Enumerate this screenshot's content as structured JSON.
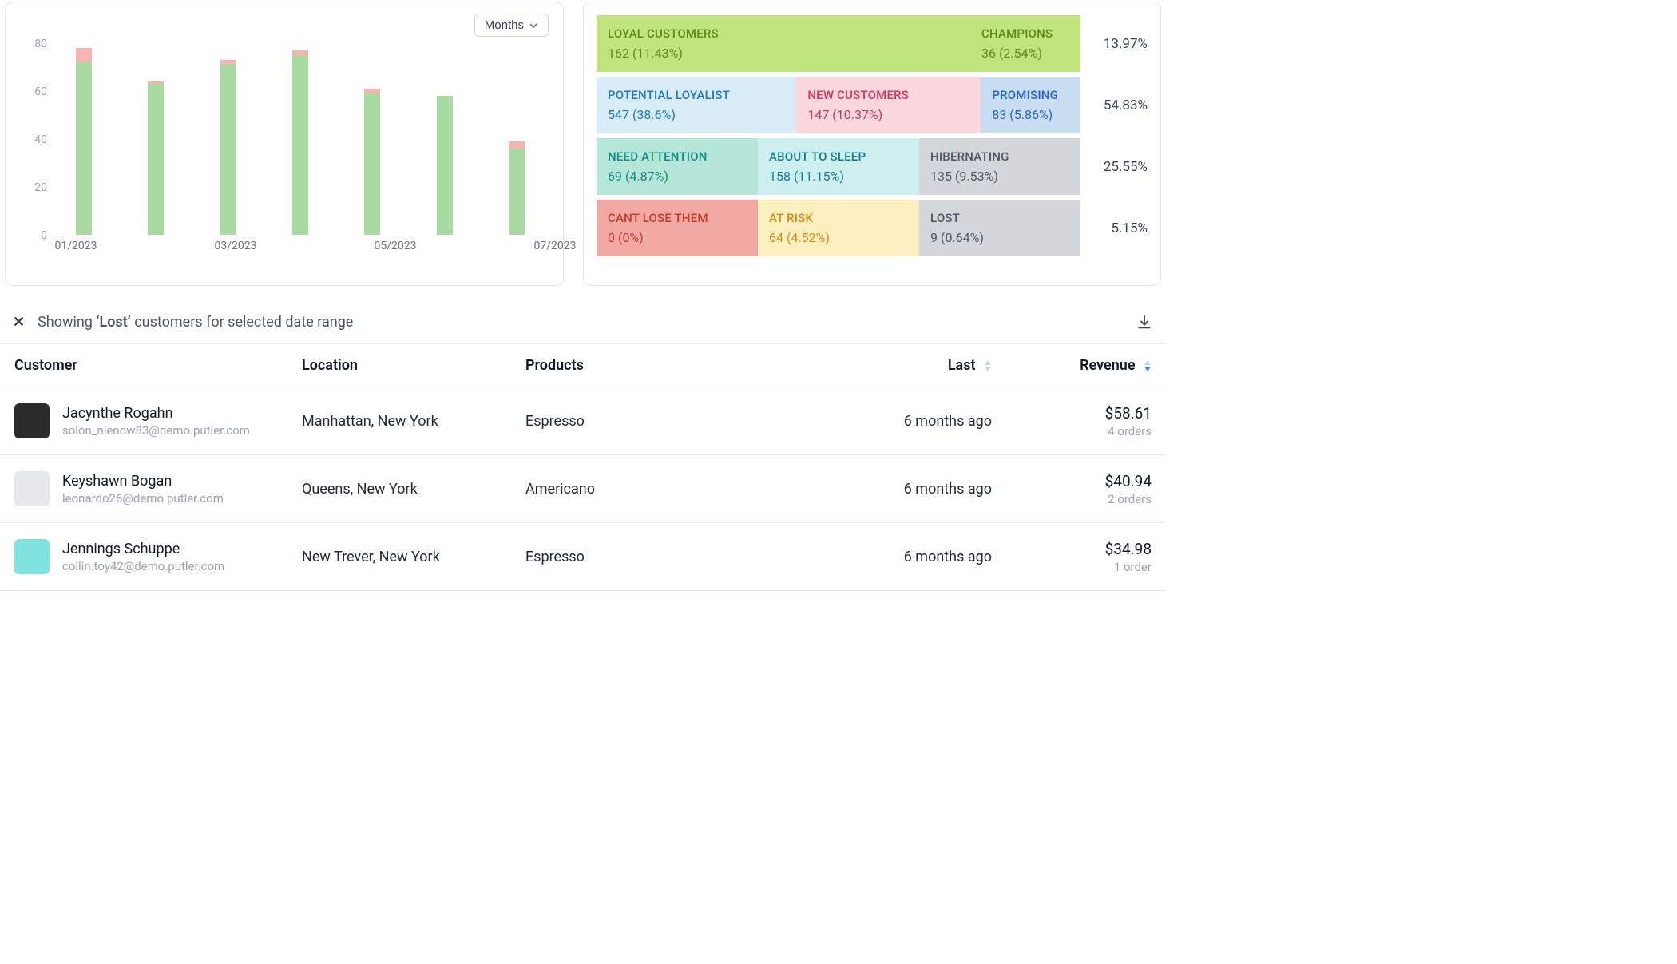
{
  "chart_data": {
    "type": "bar",
    "period_selector": "Months",
    "ylim": [
      0,
      80
    ],
    "yticks": [
      0,
      20,
      40,
      60,
      80
    ],
    "categories": [
      "01/2023",
      "02/2023",
      "03/2023",
      "04/2023",
      "05/2023",
      "06/2023",
      "07/2023"
    ],
    "x_tick_labels_shown": [
      "01/2023",
      "03/2023",
      "05/2023",
      "07/2023"
    ],
    "series": [
      {
        "name": "primary",
        "color": "#a8daa2",
        "values": [
          72,
          63,
          71,
          75,
          59,
          58,
          36
        ]
      },
      {
        "name": "secondary_cap",
        "color": "#f7b5b1",
        "values": [
          6,
          1,
          2,
          2,
          2,
          0,
          3
        ]
      }
    ]
  },
  "segments": {
    "rows": [
      {
        "pct": "13.97%",
        "tiles": [
          {
            "title": "LOYAL CUSTOMERS",
            "value": "162 (11.43%)",
            "bg": "#c0e57e",
            "fg": "#5a8a1a",
            "flex": 4
          },
          {
            "title": "CHAMPIONS",
            "value": "36 (2.54%)",
            "bg": "#c0e57e",
            "fg": "#5a8a1a",
            "flex": 1
          }
        ]
      },
      {
        "pct": "54.83%",
        "tiles": [
          {
            "title": "POTENTIAL LOYALIST",
            "value": "547 (38.6%)",
            "bg": "#d7ecf7",
            "fg": "#1f77c0",
            "flex": 2.3
          },
          {
            "title": "NEW CUSTOMERS",
            "value": "147 (10.37%)",
            "bg": "#fad6dd",
            "fg": "#d1365b",
            "flex": 2.1
          },
          {
            "title": "PROMISING",
            "value": "83 (5.86%)",
            "bg": "#c8dcf2",
            "fg": "#2763c5",
            "flex": 1
          }
        ]
      },
      {
        "pct": "25.55%",
        "tiles": [
          {
            "title": "NEED ATTENTION",
            "value": "69 (4.87%)",
            "bg": "#b6e6d8",
            "fg": "#0f8a84",
            "flex": 1
          },
          {
            "title": "ABOUT TO SLEEP",
            "value": "158 (11.15%)",
            "bg": "#cdeff0",
            "fg": "#147a8e",
            "flex": 1
          },
          {
            "title": "HIBERNATING",
            "value": "135 (9.53%)",
            "bg": "#d3d7dc",
            "fg": "#4b5563",
            "flex": 1
          }
        ]
      },
      {
        "pct": "5.15%",
        "tiles": [
          {
            "title": "CANT LOSE THEM",
            "value": "0 (0%)",
            "bg": "#f2a9a3",
            "fg": "#c0392b",
            "flex": 1
          },
          {
            "title": "AT RISK",
            "value": "64 (4.52%)",
            "bg": "#fcefc0",
            "fg": "#d98c12",
            "flex": 1
          },
          {
            "title": "LOST",
            "value": "9 (0.64%)",
            "bg": "#d3d7dc",
            "fg": "#4b5563",
            "flex": 1
          }
        ]
      }
    ]
  },
  "filter_banner": {
    "prefix": "Showing ",
    "segment_quoted": "‘Lost’",
    "suffix": " customers for selected date range"
  },
  "table": {
    "columns": {
      "customer": "Customer",
      "location": "Location",
      "products": "Products",
      "last": "Last",
      "revenue": "Revenue"
    },
    "rows": [
      {
        "name": "Jacynthe Rogahn",
        "email": "solon_nienow83@demo.putler.com",
        "avatar_bg": "#2b2b2b",
        "location": "Manhattan, New York",
        "products": "Espresso",
        "last": "6 months ago",
        "revenue": "$58.61",
        "orders": "4 orders"
      },
      {
        "name": "Keyshawn Bogan",
        "email": "leonardo26@demo.putler.com",
        "avatar_bg": "#e5e7eb",
        "location": "Queens, New York",
        "products": "Americano",
        "last": "6 months ago",
        "revenue": "$40.94",
        "orders": "2 orders"
      },
      {
        "name": "Jennings Schuppe",
        "email": "collin.toy42@demo.putler.com",
        "avatar_bg": "#7fe3e0",
        "location": "New Trever, New York",
        "products": "Espresso",
        "last": "6 months ago",
        "revenue": "$34.98",
        "orders": "1 order"
      }
    ]
  }
}
